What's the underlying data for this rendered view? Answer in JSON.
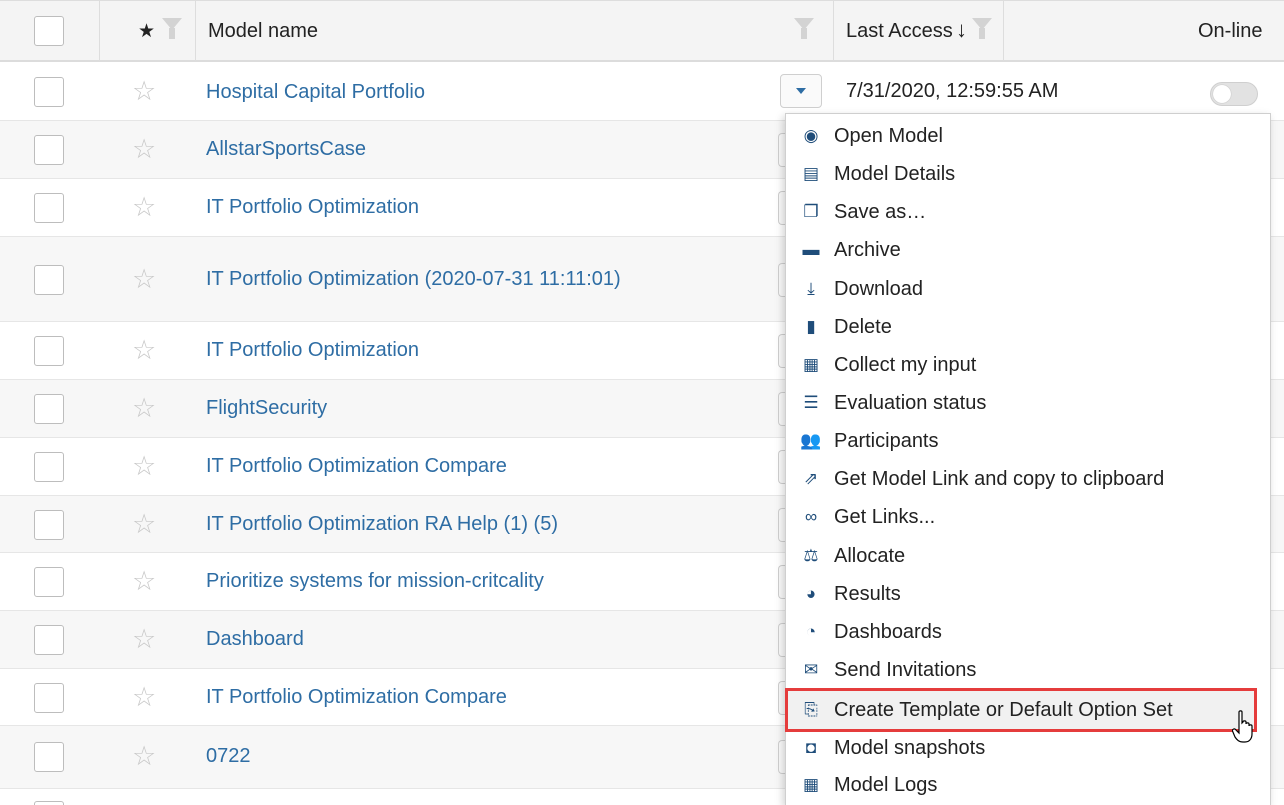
{
  "header": {
    "star_symbol": "★",
    "model_name_label": "Model name",
    "last_access_label": "Last Access",
    "sort_arrow": "↓",
    "online_label": "On-line"
  },
  "rows": [
    {
      "name": "Hospital Capital Portfolio",
      "last_access": "7/31/2020, 12:59:55 AM",
      "online": false
    },
    {
      "name": "AllstarSportsCase"
    },
    {
      "name": "IT Portfolio Optimization"
    },
    {
      "name": "IT Portfolio Optimization (2020-07-31 11:11:01)"
    },
    {
      "name": "IT Portfolio Optimization"
    },
    {
      "name": "FlightSecurity"
    },
    {
      "name": "IT Portfolio Optimization Compare"
    },
    {
      "name": "IT Portfolio Optimization RA Help (1) (5)"
    },
    {
      "name": "Prioritize systems for mission-critcality"
    },
    {
      "name": "Dashboard"
    },
    {
      "name": "IT Portfolio Optimization Compare"
    },
    {
      "name": "0722"
    }
  ],
  "row_star": "☆",
  "menu": {
    "items": [
      {
        "label": "Open Model",
        "icon": "eye-icon",
        "glyph": "◉"
      },
      {
        "label": "Model Details",
        "icon": "document-details-icon",
        "glyph": "▤"
      },
      {
        "label": "Save as…",
        "icon": "copy-icon",
        "glyph": "❐"
      },
      {
        "label": "Archive",
        "icon": "archive-icon",
        "glyph": "▬"
      },
      {
        "label": "Download",
        "icon": "download-icon",
        "glyph": "⤓"
      },
      {
        "label": "Delete",
        "icon": "trash-icon",
        "glyph": "▮"
      },
      {
        "label": "Collect my input",
        "icon": "clipboard-icon",
        "glyph": "▦"
      },
      {
        "label": "Evaluation status",
        "icon": "checklist-icon",
        "glyph": "☰"
      },
      {
        "label": "Participants",
        "icon": "users-icon",
        "glyph": "👥"
      },
      {
        "label": "Get Model Link and copy to clipboard",
        "icon": "external-link-icon",
        "glyph": "⇗"
      },
      {
        "label": "Get Links...",
        "icon": "link-icon",
        "glyph": "∞"
      },
      {
        "label": "Allocate",
        "icon": "balance-scale-icon",
        "glyph": "⚖"
      },
      {
        "label": "Results",
        "icon": "pie-chart-icon",
        "glyph": "◕"
      },
      {
        "label": "Dashboards",
        "icon": "tachometer-icon",
        "glyph": "◔"
      },
      {
        "label": "Send Invitations",
        "icon": "envelope-icon",
        "glyph": "✉"
      },
      {
        "label": "Create Template or Default Option Set",
        "icon": "template-copy-icon",
        "glyph": "⎘"
      },
      {
        "label": "Model snapshots",
        "icon": "snapshot-icon",
        "glyph": "◘"
      },
      {
        "label": "Model Logs",
        "icon": "calendar-icon",
        "glyph": "▦"
      }
    ]
  }
}
